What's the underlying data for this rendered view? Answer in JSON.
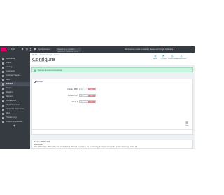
{
  "topbar": {
    "version": "1.7.8.10",
    "links": [
      "Quick Access ▾"
    ],
    "search_placeholder": "Search (e.g.: product reference, customer name...)",
    "right_text": "Maintenance mode is enabled, please don't forget to disable it",
    "shop_label": "View my shop",
    "colors": {
      "bar": "#363a41",
      "logo": "#df0067"
    }
  },
  "sidebar": {
    "items": [
      {
        "label": "Dashboard",
        "icon": "trending-icon"
      },
      {
        "label": "Orders",
        "icon": "cart-icon"
      },
      {
        "label": "Catalog",
        "icon": "store-icon"
      },
      {
        "label": "Customers",
        "icon": "person-icon"
      },
      {
        "label": "Customer Service",
        "icon": "chat-icon"
      },
      {
        "label": "Stats",
        "icon": "chart-icon"
      },
      {
        "label": "Modules",
        "icon": "puzzle-icon",
        "active": true
      },
      {
        "label": "Design",
        "icon": "desktop-icon"
      },
      {
        "label": "Shipping",
        "icon": "truck-icon"
      },
      {
        "label": "Payment",
        "icon": "card-icon"
      },
      {
        "label": "International",
        "icon": "globe-icon"
      },
      {
        "label": "Shop Parameters",
        "icon": "settings-icon"
      },
      {
        "label": "Advanced Parameters",
        "icon": "gears-icon"
      },
      {
        "label": "Xbox",
        "icon": "box-icon"
      },
      {
        "label": "Themeconfig",
        "icon": "brush-icon"
      },
      {
        "label": "Product Accessories",
        "icon": "link-icon"
      }
    ],
    "add_label": "+"
  },
  "header": {
    "breadcrumb": "Modules ›  Module Manager ›  Fortune",
    "title": "Configure",
    "subtitle": "Fortune PDP (v1.0)",
    "toolbar": [
      {
        "label": "Back",
        "icon": "back-icon"
      },
      {
        "label": "Translate",
        "icon": "flag-icon"
      },
      {
        "label": "Check update",
        "icon": "refresh-icon"
      },
      {
        "label": "Manage hooks",
        "icon": "anchor-icon"
      }
    ]
  },
  "alert": {
    "text": "Settings updated successfully.",
    "color": "#cdf2e0"
  },
  "panel": {
    "heading": "Settings",
    "rows": [
      {
        "label": "Fortune PDP",
        "yes": "YES",
        "no": "NO"
      },
      {
        "label": "Fortune CAT",
        "yes": "YES",
        "no": "NO"
      },
      {
        "label": "Mode 3",
        "yes": "YES",
        "no": "NO"
      }
    ],
    "save_label": "Save"
  },
  "info_panel": {
    "heading": "Fortune PDP (v1.0)",
    "subheading": "Description",
    "text": "Note: With fortune PDP enabled the hook shows a PDP with the warning, the text showing the original price on the product detail page on the left."
  }
}
